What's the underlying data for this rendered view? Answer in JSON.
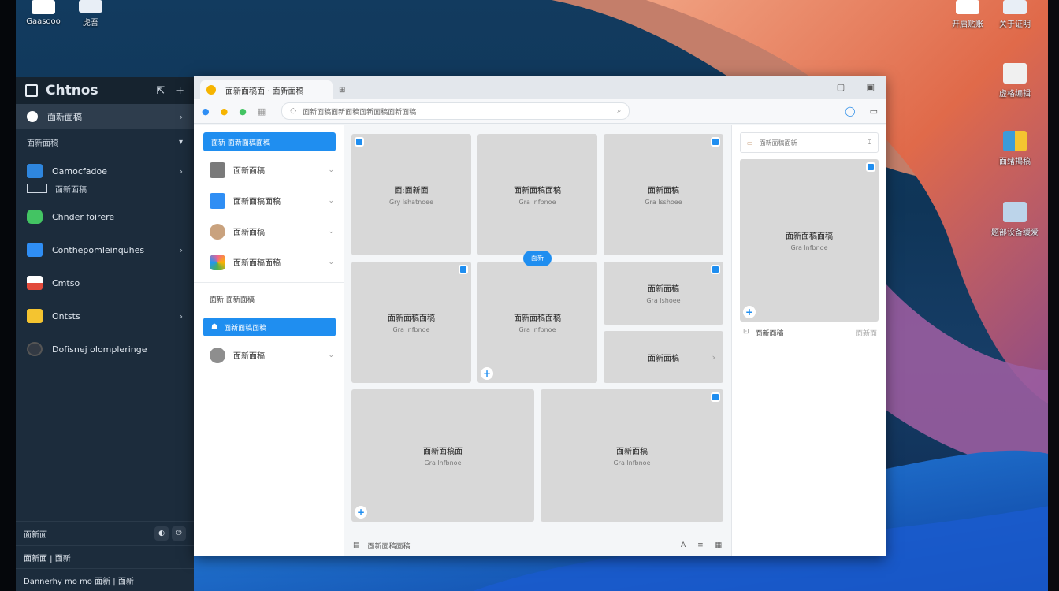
{
  "desktop": {
    "top_left_icons": [
      {
        "label": "Gaasooo",
        "color": "#ffffff"
      },
      {
        "label": "虎吾",
        "color": "#e8eef6"
      }
    ],
    "top_right_icons": [
      {
        "label": "开启贴账",
        "color": "#ffffff"
      },
      {
        "label": "关于证明",
        "color": "#e8eef6"
      }
    ],
    "right_icons": [
      {
        "label": "虚格编辑",
        "color": "#f0f0f0"
      },
      {
        "label": "面绪揭稿",
        "color": "#3b9bd9"
      },
      {
        "label": "题部设备缓爱",
        "color": "#bcd4ea"
      }
    ]
  },
  "left_panel": {
    "title": "Chtnos",
    "header_icons": [
      "pin-icon",
      "plus-icon"
    ],
    "items": [
      {
        "label": "面新面稿",
        "icon_color": "#ffffff",
        "active": true,
        "chevron": true
      },
      {
        "label": "面新面稿",
        "icon_color": "",
        "section": true,
        "chevron": true
      },
      {
        "label": "Oamocfadoe",
        "icon_color": "#2e86de",
        "chevron": true
      },
      {
        "label": "面新面稿",
        "icon_color": "",
        "sub": true
      },
      {
        "label": "Chnder foirere",
        "icon_color": "#43c463"
      },
      {
        "label": "Conthepomleinquhes",
        "icon_color": "#2f8ef4",
        "chevron": true
      },
      {
        "label": "Cmtso",
        "icon_color": "#e24a3b"
      },
      {
        "label": "Ontsts",
        "icon_color": "#f4c430",
        "chevron": true
      },
      {
        "label": "Dofisnej olompleringe",
        "icon_color": "#333a44"
      }
    ],
    "footer": [
      {
        "label": "面新面"
      },
      {
        "label": "面新面 | 面新|"
      },
      {
        "label": "Dannerhy mo mo 面新 | 面新"
      }
    ]
  },
  "browser": {
    "tab_title": "面新面稿面 · 面新面稿",
    "url": "面新面稿面新面稿面新面稿面新面稿",
    "sidebar": {
      "active_item": "面新  面新面稿面稿",
      "items": [
        {
          "label": "面新面稿",
          "icon_color": "#7a7a7a"
        },
        {
          "label": "面新面稿面稿",
          "icon_color": "#2f8ef4"
        },
        {
          "label": "面新面稿",
          "icon_color": "#c9a27e"
        },
        {
          "label": "面新面稿面稿",
          "icon_color": "#f06292"
        }
      ],
      "section_title": "面新 面新面稿",
      "section_active": "面新面稿面稿",
      "section_items": [
        {
          "label": "面新面稿",
          "icon_color": "#8e8e8e"
        }
      ]
    },
    "cards": [
      {
        "title": "面:面新面",
        "subtitle": "Gry lshatnoee"
      },
      {
        "title": "面新面稿面稿",
        "subtitle": "Gra lnfbnoe"
      },
      {
        "title": "面新面稿",
        "subtitle": "Gra lsshoee"
      },
      {
        "title": "面新面稿面稿",
        "subtitle": "Gra lnfbnoe"
      },
      {
        "title": "面新面稿面稿",
        "subtitle": "Gra lnfbnoe"
      },
      {
        "title": "面新面稿",
        "subtitle": "Gra lshoee"
      },
      {
        "title": "面新面稿",
        "subtitle": ""
      },
      {
        "title": "面新面稿面",
        "subtitle": "Gra lnfbnoe"
      },
      {
        "title": "面新面稿",
        "subtitle": "Gra lnfbnoe"
      }
    ],
    "pill_label": "面新",
    "status_text": "面新面稿面稿",
    "status_icons": [
      "text-icon",
      "list-icon",
      "grid-icon"
    ],
    "right_panel": {
      "search_text": "面新面稿面新",
      "card_title": "面新面稿面稿",
      "card_subtitle": "Gra lnfbnoe",
      "meta_label": "面新面稿",
      "meta_right": "面新面"
    }
  }
}
